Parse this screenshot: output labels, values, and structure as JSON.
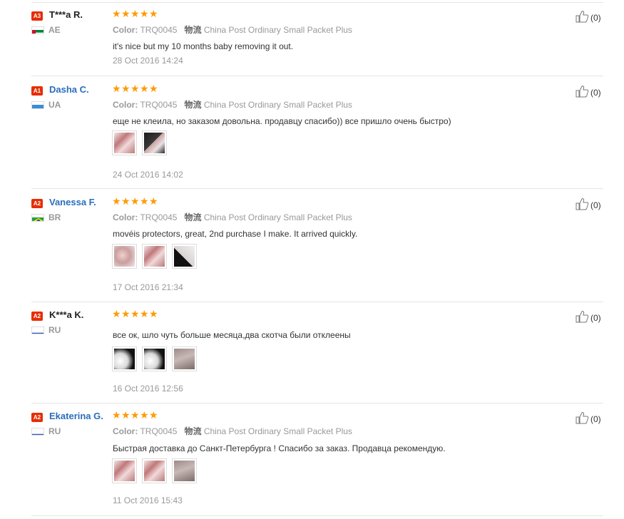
{
  "labels": {
    "color": "Color:",
    "shipping": "物流"
  },
  "reviews": [
    {
      "level": "A3",
      "name": "T***a R.",
      "name_style": "anon",
      "country": "AE",
      "flag": "ae",
      "stars": 5,
      "color_value": "TRQ0045",
      "shipping_value": "China Post Ordinary Small Packet Plus",
      "show_meta": true,
      "text": "it's nice but my 10 months baby removing it out.",
      "images": [],
      "date": "28 Oct 2016 14:24",
      "likes": "(0)"
    },
    {
      "level": "A1",
      "name": "Dasha C.",
      "name_style": "user",
      "country": "UA",
      "flag": "ua",
      "stars": 5,
      "color_value": "TRQ0045",
      "shipping_value": "China Post Ordinary Small Packet Plus",
      "show_meta": true,
      "text": "еще не клеила, но заказом довольна. продавцу спасибо)) все пришло очень быстро)",
      "images": [
        "t-red",
        "t-dark"
      ],
      "date": "24 Oct 2016 14:02",
      "likes": "(0)"
    },
    {
      "level": "A2",
      "name": "Vanessa F.",
      "name_style": "user",
      "country": "BR",
      "flag": "br",
      "stars": 5,
      "color_value": "TRQ0045",
      "shipping_value": "China Post Ordinary Small Packet Plus",
      "show_meta": true,
      "text": "movéis protectors, great, 2nd purchase I make. It arrived quickly.",
      "images": [
        "t-pink",
        "t-red",
        "t-black"
      ],
      "date": "17 Oct 2016 21:34",
      "likes": "(0)"
    },
    {
      "level": "A2",
      "name": "K***a K.",
      "name_style": "anon",
      "country": "RU",
      "flag": "ru",
      "stars": 5,
      "color_value": "",
      "shipping_value": "",
      "show_meta": false,
      "text": "все ок, шло чуть больше месяца,два скотча были отклеены",
      "images": [
        "t-white",
        "t-white",
        "t-gray"
      ],
      "date": "16 Oct 2016 12:56",
      "likes": "(0)"
    },
    {
      "level": "A2",
      "name": "Ekaterina G.",
      "name_style": "user",
      "country": "RU",
      "flag": "ru",
      "stars": 5,
      "color_value": "TRQ0045",
      "shipping_value": "China Post Ordinary Small Packet Plus",
      "show_meta": true,
      "text": "Быстрая доставка до Санкт-Петербурга ! Спасибо за заказ. Продавца рекомендую.",
      "images": [
        "t-red",
        "t-red",
        "t-gray"
      ],
      "date": "11 Oct 2016 15:43",
      "likes": "(0)"
    }
  ]
}
